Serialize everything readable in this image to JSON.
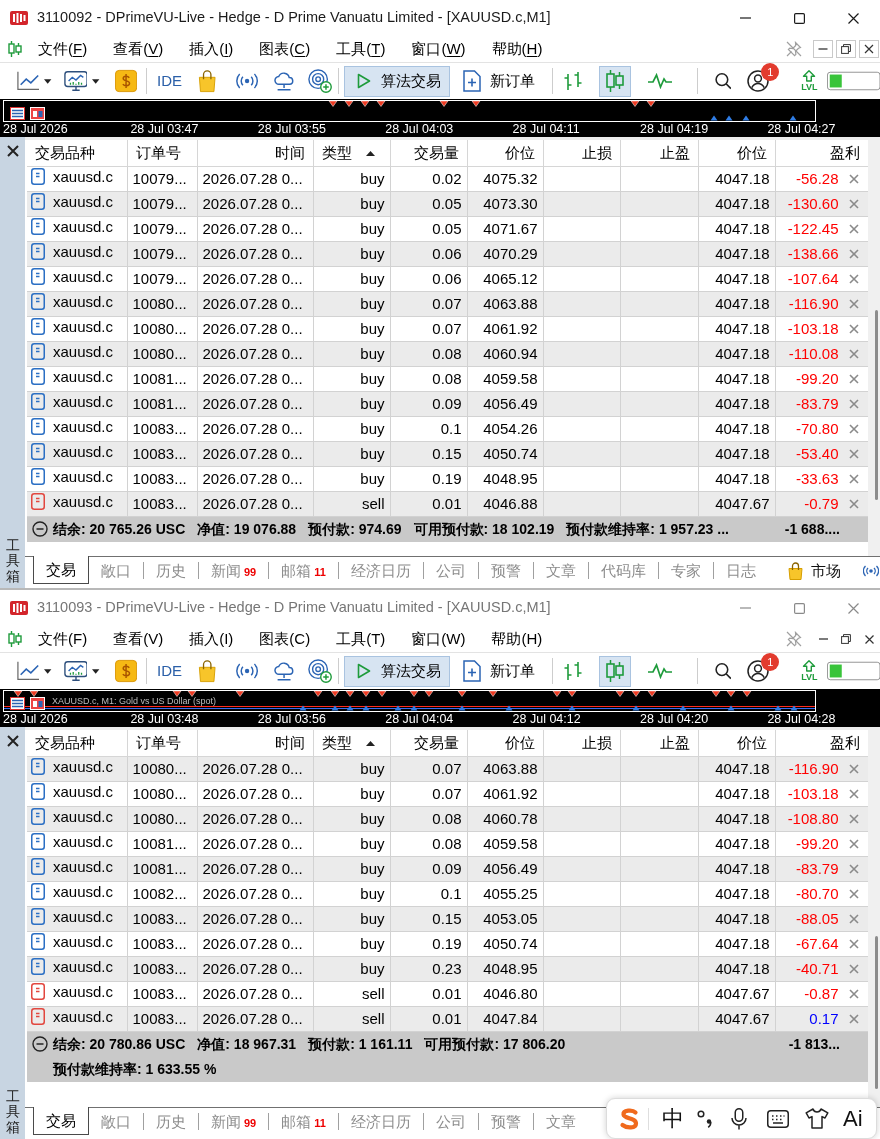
{
  "windows": [
    {
      "active": true,
      "title": "3110092 - DPrimeVU-Live - Hedge - D Prime Vanuatu Limited - [XAUUSD.c,M1]",
      "menu_mnemonics_underlined": true,
      "menu": [
        "文件(F)",
        "查看(V)",
        "插入(I)",
        "图表(C)",
        "工具(T)",
        "窗口(W)",
        "帮助(H)"
      ],
      "toolbar": {
        "ide_label": "IDE",
        "algo_trading": {
          "label": "算法交易",
          "on": true
        },
        "new_order_label": "新订单",
        "chart_types": [
          {
            "selected": false
          },
          {
            "selected": true
          },
          {
            "selected": false
          }
        ],
        "notification_count": "1",
        "lvl_label": "LVL"
      },
      "chart_strip": {
        "time_labels": [
          "28 Jul 2026",
          "28 Jul 03:47",
          "28 Jul 03:55",
          "28 Jul 04:03",
          "28 Jul 04:11",
          "28 Jul 04:19",
          "28 Jul 04:27"
        ]
      },
      "toolbox_label": "工具箱",
      "table": {
        "first_row_shaded": false,
        "columns": [
          {
            "label": "交易品种",
            "sorted": false
          },
          {
            "label": "订单号",
            "sorted": false
          },
          {
            "label": "时间",
            "sorted": false
          },
          {
            "label": "类型",
            "sorted": true
          },
          {
            "label": "交易量",
            "sorted": false
          },
          {
            "label": "价位",
            "sorted": false
          },
          {
            "label": "止损",
            "sorted": false
          },
          {
            "label": "止盈",
            "sorted": false
          },
          {
            "label": "价位",
            "sorted": false
          },
          {
            "label": "盈利",
            "sorted": false
          }
        ],
        "rows": [
          {
            "kind": "buy",
            "symbol": "xauusd.c",
            "ticket": "10079...",
            "time": "2026.07.28 0...",
            "type": "buy",
            "volume": "0.02",
            "price": "4075.32",
            "current_price": "4047.18",
            "profit": "-56.28",
            "color": "#ff0000"
          },
          {
            "kind": "buy",
            "symbol": "xauusd.c",
            "ticket": "10079...",
            "time": "2026.07.28 0...",
            "type": "buy",
            "volume": "0.05",
            "price": "4073.30",
            "current_price": "4047.18",
            "profit": "-130.60",
            "color": "#ff0000"
          },
          {
            "kind": "buy",
            "symbol": "xauusd.c",
            "ticket": "10079...",
            "time": "2026.07.28 0...",
            "type": "buy",
            "volume": "0.05",
            "price": "4071.67",
            "current_price": "4047.18",
            "profit": "-122.45",
            "color": "#ff0000"
          },
          {
            "kind": "buy",
            "symbol": "xauusd.c",
            "ticket": "10079...",
            "time": "2026.07.28 0...",
            "type": "buy",
            "volume": "0.06",
            "price": "4070.29",
            "current_price": "4047.18",
            "profit": "-138.66",
            "color": "#ff0000"
          },
          {
            "kind": "buy",
            "symbol": "xauusd.c",
            "ticket": "10079...",
            "time": "2026.07.28 0...",
            "type": "buy",
            "volume": "0.06",
            "price": "4065.12",
            "current_price": "4047.18",
            "profit": "-107.64",
            "color": "#ff0000"
          },
          {
            "kind": "buy",
            "symbol": "xauusd.c",
            "ticket": "10080...",
            "time": "2026.07.28 0...",
            "type": "buy",
            "volume": "0.07",
            "price": "4063.88",
            "current_price": "4047.18",
            "profit": "-116.90",
            "color": "#ff0000"
          },
          {
            "kind": "buy",
            "symbol": "xauusd.c",
            "ticket": "10080...",
            "time": "2026.07.28 0...",
            "type": "buy",
            "volume": "0.07",
            "price": "4061.92",
            "current_price": "4047.18",
            "profit": "-103.18",
            "color": "#ff0000"
          },
          {
            "kind": "buy",
            "symbol": "xauusd.c",
            "ticket": "10080...",
            "time": "2026.07.28 0...",
            "type": "buy",
            "volume": "0.08",
            "price": "4060.94",
            "current_price": "4047.18",
            "profit": "-110.08",
            "color": "#ff0000"
          },
          {
            "kind": "buy",
            "symbol": "xauusd.c",
            "ticket": "10081...",
            "time": "2026.07.28 0...",
            "type": "buy",
            "volume": "0.08",
            "price": "4059.58",
            "current_price": "4047.18",
            "profit": "-99.20",
            "color": "#ff0000"
          },
          {
            "kind": "buy",
            "symbol": "xauusd.c",
            "ticket": "10081...",
            "time": "2026.07.28 0...",
            "type": "buy",
            "volume": "0.09",
            "price": "4056.49",
            "current_price": "4047.18",
            "profit": "-83.79",
            "color": "#ff0000"
          },
          {
            "kind": "buy",
            "symbol": "xauusd.c",
            "ticket": "10083...",
            "time": "2026.07.28 0...",
            "type": "buy",
            "volume": "0.1",
            "price": "4054.26",
            "current_price": "4047.18",
            "profit": "-70.80",
            "color": "#ff0000"
          },
          {
            "kind": "buy",
            "symbol": "xauusd.c",
            "ticket": "10083...",
            "time": "2026.07.28 0...",
            "type": "buy",
            "volume": "0.15",
            "price": "4050.74",
            "current_price": "4047.18",
            "profit": "-53.40",
            "color": "#ff0000"
          },
          {
            "kind": "buy",
            "symbol": "xauusd.c",
            "ticket": "10083...",
            "time": "2026.07.28 0...",
            "type": "buy",
            "volume": "0.19",
            "price": "4048.95",
            "current_price": "4047.18",
            "profit": "-33.63",
            "color": "#ff0000"
          },
          {
            "kind": "sell",
            "symbol": "xauusd.c",
            "ticket": "10083...",
            "time": "2026.07.28 0...",
            "type": "sell",
            "volume": "0.01",
            "price": "4046.88",
            "current_price": "4047.67",
            "profit": "-0.79",
            "color": "#ff0000"
          }
        ]
      },
      "summary": {
        "lines": [
          [
            "结余: 20 765.26 USC",
            "净值: 19 076.88",
            "预付款: 974.69",
            "可用预付款: 18 102.19",
            "预付款维持率: 1 957.23 ..."
          ]
        ],
        "total": "-1 688...."
      },
      "tabs": [
        {
          "label": "交易",
          "kind": "plain",
          "selected": true
        },
        {
          "label": "敞口",
          "kind": "plain",
          "selected": false
        },
        {
          "label": "历史",
          "kind": "plain",
          "selected": false
        },
        {
          "label": "新闻",
          "badge": "99",
          "kind": "plain",
          "selected": false
        },
        {
          "label": "邮箱",
          "badge": "11",
          "kind": "plain",
          "selected": false
        },
        {
          "label": "经济日历",
          "kind": "plain",
          "selected": false
        },
        {
          "label": "公司",
          "kind": "plain",
          "selected": false
        },
        {
          "label": "预警",
          "kind": "plain",
          "selected": false
        },
        {
          "label": "文章",
          "kind": "plain",
          "selected": false
        },
        {
          "label": "代码库",
          "kind": "plain",
          "selected": false
        },
        {
          "label": "专家",
          "kind": "plain",
          "selected": false
        },
        {
          "label": "日志",
          "kind": "plain",
          "selected": false
        },
        {
          "label": "市场",
          "kind": "market",
          "selected": false
        }
      ]
    },
    {
      "active": false,
      "title": "3110093 - DPrimeVU-Live - Hedge - D Prime Vanuatu Limited - [XAUUSD.c,M1]",
      "menu_mnemonics_underlined": false,
      "menu": [
        "文件(F)",
        "查看(V)",
        "插入(I)",
        "图表(C)",
        "工具(T)",
        "窗口(W)",
        "帮助(H)"
      ],
      "toolbar": {
        "ide_label": "IDE",
        "algo_trading": {
          "label": "算法交易",
          "on": true
        },
        "new_order_label": "新订单",
        "chart_types": [
          {
            "selected": false
          },
          {
            "selected": true
          },
          {
            "selected": false
          }
        ],
        "notification_count": "1",
        "lvl_label": "LVL"
      },
      "chart_strip": {
        "caption": "XAUUSD.c, M1: Gold vs US Dollar (spot)",
        "time_labels": [
          "28 Jul 2026",
          "28 Jul 03:48",
          "28 Jul 03:56",
          "28 Jul 04:04",
          "28 Jul 04:12",
          "28 Jul 04:20",
          "28 Jul 04:28"
        ]
      },
      "toolbox_label": "工具箱",
      "table": {
        "first_row_shaded": true,
        "columns": [
          {
            "label": "交易品种",
            "sorted": false
          },
          {
            "label": "订单号",
            "sorted": false
          },
          {
            "label": "时间",
            "sorted": false
          },
          {
            "label": "类型",
            "sorted": true
          },
          {
            "label": "交易量",
            "sorted": false
          },
          {
            "label": "价位",
            "sorted": false
          },
          {
            "label": "止损",
            "sorted": false
          },
          {
            "label": "止盈",
            "sorted": false
          },
          {
            "label": "价位",
            "sorted": false
          },
          {
            "label": "盈利",
            "sorted": false
          }
        ],
        "rows": [
          {
            "kind": "buy",
            "symbol": "xauusd.c",
            "ticket": "10080...",
            "time": "2026.07.28 0...",
            "type": "buy",
            "volume": "0.07",
            "price": "4063.88",
            "current_price": "4047.18",
            "profit": "-116.90",
            "color": "#ff0000"
          },
          {
            "kind": "buy",
            "symbol": "xauusd.c",
            "ticket": "10080...",
            "time": "2026.07.28 0...",
            "type": "buy",
            "volume": "0.07",
            "price": "4061.92",
            "current_price": "4047.18",
            "profit": "-103.18",
            "color": "#ff0000"
          },
          {
            "kind": "buy",
            "symbol": "xauusd.c",
            "ticket": "10080...",
            "time": "2026.07.28 0...",
            "type": "buy",
            "volume": "0.08",
            "price": "4060.78",
            "current_price": "4047.18",
            "profit": "-108.80",
            "color": "#ff0000"
          },
          {
            "kind": "buy",
            "symbol": "xauusd.c",
            "ticket": "10081...",
            "time": "2026.07.28 0...",
            "type": "buy",
            "volume": "0.08",
            "price": "4059.58",
            "current_price": "4047.18",
            "profit": "-99.20",
            "color": "#ff0000"
          },
          {
            "kind": "buy",
            "symbol": "xauusd.c",
            "ticket": "10081...",
            "time": "2026.07.28 0...",
            "type": "buy",
            "volume": "0.09",
            "price": "4056.49",
            "current_price": "4047.18",
            "profit": "-83.79",
            "color": "#ff0000"
          },
          {
            "kind": "buy",
            "symbol": "xauusd.c",
            "ticket": "10082...",
            "time": "2026.07.28 0...",
            "type": "buy",
            "volume": "0.1",
            "price": "4055.25",
            "current_price": "4047.18",
            "profit": "-80.70",
            "color": "#ff0000"
          },
          {
            "kind": "buy",
            "symbol": "xauusd.c",
            "ticket": "10083...",
            "time": "2026.07.28 0...",
            "type": "buy",
            "volume": "0.15",
            "price": "4053.05",
            "current_price": "4047.18",
            "profit": "-88.05",
            "color": "#ff0000"
          },
          {
            "kind": "buy",
            "symbol": "xauusd.c",
            "ticket": "10083...",
            "time": "2026.07.28 0...",
            "type": "buy",
            "volume": "0.19",
            "price": "4050.74",
            "current_price": "4047.18",
            "profit": "-67.64",
            "color": "#ff0000"
          },
          {
            "kind": "buy",
            "symbol": "xauusd.c",
            "ticket": "10083...",
            "time": "2026.07.28 0...",
            "type": "buy",
            "volume": "0.23",
            "price": "4048.95",
            "current_price": "4047.18",
            "profit": "-40.71",
            "color": "#ff0000"
          },
          {
            "kind": "sell",
            "symbol": "xauusd.c",
            "ticket": "10083...",
            "time": "2026.07.28 0...",
            "type": "sell",
            "volume": "0.01",
            "price": "4046.80",
            "current_price": "4047.67",
            "profit": "-0.87",
            "color": "#ff0000"
          },
          {
            "kind": "sell",
            "symbol": "xauusd.c",
            "ticket": "10083...",
            "time": "2026.07.28 0...",
            "type": "sell",
            "volume": "0.01",
            "price": "4047.84",
            "current_price": "4047.67",
            "profit": "0.17",
            "color": "#0000ff"
          }
        ]
      },
      "summary": {
        "lines": [
          [
            "结余: 20 780.86 USC",
            "净值: 18 967.31",
            "预付款: 1 161.11",
            "可用预付款: 17 806.20"
          ],
          [
            "预付款维持率: 1 633.55 %"
          ]
        ],
        "total": "-1 813..."
      },
      "tabs": [
        {
          "label": "交易",
          "kind": "plain",
          "selected": true
        },
        {
          "label": "敞口",
          "kind": "plain",
          "selected": false
        },
        {
          "label": "历史",
          "kind": "plain",
          "selected": false
        },
        {
          "label": "新闻",
          "badge": "99",
          "kind": "plain",
          "selected": false
        },
        {
          "label": "邮箱",
          "badge": "11",
          "kind": "plain",
          "selected": false
        },
        {
          "label": "经济日历",
          "kind": "plain",
          "selected": false
        },
        {
          "label": "公司",
          "kind": "plain",
          "selected": false
        },
        {
          "label": "预警",
          "kind": "plain",
          "selected": false
        },
        {
          "label": "文章",
          "kind": "plain",
          "selected": false
        }
      ]
    }
  ],
  "ime_toolbar": {
    "mode_label": "中",
    "ai_label": "Ai"
  }
}
